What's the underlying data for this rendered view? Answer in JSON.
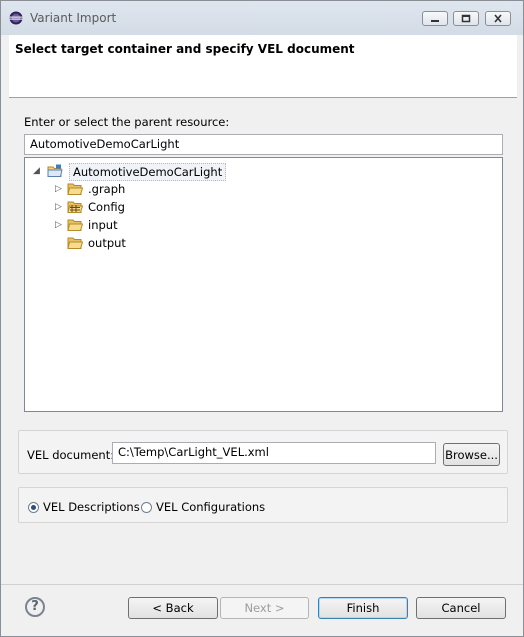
{
  "window": {
    "title": "Variant Import",
    "app_icon": "eclipse-icon",
    "controls": [
      "minimize-icon",
      "maximize-icon",
      "close-icon"
    ]
  },
  "header": {
    "title": "Select target container and specify VEL document"
  },
  "parent_resource": {
    "label": "Enter or select the parent resource:",
    "value": "AutomotiveDemoCarLight"
  },
  "tree": {
    "root": {
      "label": "AutomotiveDemoCarLight",
      "expanded": true,
      "icon": "project-folder-icon"
    },
    "children": [
      {
        "label": ".graph",
        "expandable": true,
        "icon": "folder-icon"
      },
      {
        "label": "Config",
        "expandable": true,
        "icon": "package-folder-icon"
      },
      {
        "label": "input",
        "expandable": true,
        "icon": "folder-icon"
      },
      {
        "label": "output",
        "expandable": false,
        "icon": "folder-icon"
      }
    ]
  },
  "vel_document": {
    "label": "VEL document:",
    "value": "C:\\Temp\\CarLight_VEL.xml",
    "browse_label": "Browse..."
  },
  "options": {
    "descriptions_label": "VEL Descriptions",
    "configurations_label": "VEL Configurations",
    "selected": "VEL Descriptions"
  },
  "footer": {
    "help_icon": "help-icon",
    "back_label": "< Back",
    "next_label": "Next >",
    "finish_label": "Finish",
    "cancel_label": "Cancel"
  }
}
